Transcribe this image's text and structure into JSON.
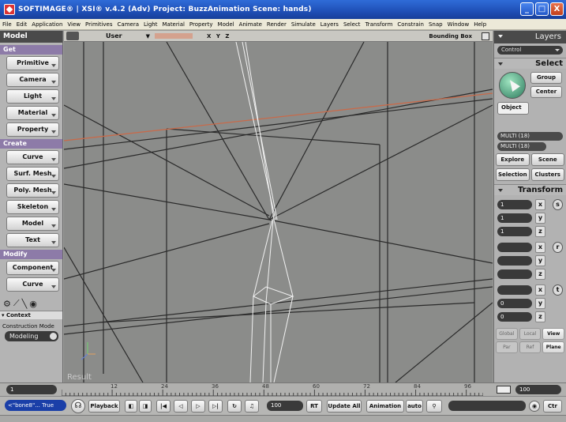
{
  "window": {
    "title": "SOFTIMAGE® | XSI® v.4.2 (Adv) Project: BuzzAnimation   Scene: hands)",
    "buttons": [
      "_",
      "□",
      "X"
    ]
  },
  "menu": [
    "File",
    "Edit",
    "Application",
    "View",
    "Primitives",
    "Camera",
    "Light",
    "Material",
    "Property",
    "Model",
    "Animate",
    "Render",
    "Simulate",
    "Layers",
    "Select",
    "Transform",
    "Constrain",
    "Snap",
    "Window",
    "Help"
  ],
  "left_panel": {
    "tab": "Model",
    "get": {
      "label": "Get",
      "buttons": [
        "Primitive",
        "Camera",
        "Light",
        "Material",
        "Property"
      ]
    },
    "create": {
      "label": "Create",
      "buttons": [
        "Curve",
        "Surf. Mesh",
        "Poly. Mesh",
        "Skeleton",
        "Model",
        "Text"
      ]
    },
    "modify": {
      "label": "Modify",
      "buttons": [
        "Component",
        "Curve"
      ]
    },
    "context": {
      "label": "▾ Context",
      "construction_label": "Construction Mode",
      "mode": "Modeling"
    }
  },
  "viewport": {
    "view": "User",
    "axes": "X Y Z",
    "bounding": "Bounding Box",
    "result": "Result"
  },
  "right_panel": {
    "layers_tab": "Layers",
    "control": "Control",
    "select": {
      "header": "Select",
      "group": "Group",
      "center": "Center",
      "object": "Object",
      "multi1": "MULTI (18)",
      "multi2": "MULTI (18)",
      "explore": "Explore",
      "scene": "Scene",
      "selection": "Selection",
      "clusters": "Clusters"
    },
    "transform": {
      "header": "Transform",
      "scale": [
        "1",
        "1",
        "1"
      ],
      "rotate": [
        "",
        "",
        ""
      ],
      "translate": [
        "",
        "0",
        "0"
      ],
      "axes": [
        "x",
        "y",
        "z"
      ],
      "modes": [
        "s",
        "r",
        "t"
      ],
      "ref": [
        "Global",
        "Local",
        "View"
      ],
      "ref2": [
        "Par",
        "Ref",
        "Plane"
      ]
    }
  },
  "timeline": {
    "start": "1",
    "end": "100",
    "ticks": [
      "12",
      "24",
      "36",
      "48",
      "60",
      "72",
      "84",
      "96"
    ]
  },
  "bottom": {
    "selection": "<\"bone8\"... True",
    "playback": "Playback",
    "frame": "100",
    "rt": "RT",
    "update": "Update All",
    "animation": "Animation",
    "auto": "auto",
    "ctr": "Ctr"
  }
}
